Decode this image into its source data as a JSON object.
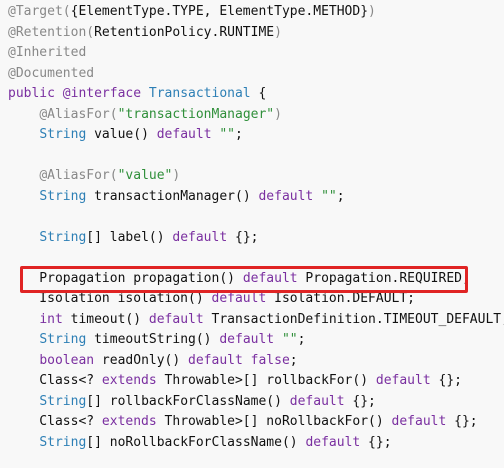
{
  "colors": {
    "background": "#f8f8f8",
    "annotation": "#888888",
    "keyword": "#7a2fa0",
    "string": "#2f8f3a",
    "type": "#2d7fb5",
    "plain": "#111111",
    "highlight_border": "#e02424"
  },
  "code": {
    "highlighted_line_index": 13,
    "lines": [
      [
        {
          "t": "@Target(",
          "c": "ann"
        },
        {
          "t": "{ElementType.TYPE, ElementType.METHOD}",
          "c": "pln"
        },
        {
          "t": ")",
          "c": "ann"
        }
      ],
      [
        {
          "t": "@Retention(",
          "c": "ann"
        },
        {
          "t": "RetentionPolicy.RUNTIME",
          "c": "pln"
        },
        {
          "t": ")",
          "c": "ann"
        }
      ],
      [
        {
          "t": "@Inherited",
          "c": "ann"
        }
      ],
      [
        {
          "t": "@Documented",
          "c": "ann"
        }
      ],
      [
        {
          "t": "public ",
          "c": "kw"
        },
        {
          "t": "@interface ",
          "c": "kw"
        },
        {
          "t": "Transactional",
          "c": "typ"
        },
        {
          "t": " {",
          "c": "pln"
        }
      ],
      [
        {
          "t": "    ",
          "c": "pln"
        },
        {
          "t": "@AliasFor(",
          "c": "ann"
        },
        {
          "t": "\"transactionManager\"",
          "c": "str"
        },
        {
          "t": ")",
          "c": "ann"
        }
      ],
      [
        {
          "t": "    ",
          "c": "pln"
        },
        {
          "t": "String",
          "c": "typ"
        },
        {
          "t": " value() ",
          "c": "pln"
        },
        {
          "t": "default",
          "c": "kw"
        },
        {
          "t": " ",
          "c": "pln"
        },
        {
          "t": "\"\"",
          "c": "str"
        },
        {
          "t": ";",
          "c": "pln"
        }
      ],
      [],
      [
        {
          "t": "    ",
          "c": "pln"
        },
        {
          "t": "@AliasFor(",
          "c": "ann"
        },
        {
          "t": "\"value\"",
          "c": "str"
        },
        {
          "t": ")",
          "c": "ann"
        }
      ],
      [
        {
          "t": "    ",
          "c": "pln"
        },
        {
          "t": "String",
          "c": "typ"
        },
        {
          "t": " transactionManager() ",
          "c": "pln"
        },
        {
          "t": "default",
          "c": "kw"
        },
        {
          "t": " ",
          "c": "pln"
        },
        {
          "t": "\"\"",
          "c": "str"
        },
        {
          "t": ";",
          "c": "pln"
        }
      ],
      [],
      [
        {
          "t": "    ",
          "c": "pln"
        },
        {
          "t": "String",
          "c": "typ"
        },
        {
          "t": "[] label() ",
          "c": "pln"
        },
        {
          "t": "default",
          "c": "kw"
        },
        {
          "t": " {};",
          "c": "pln"
        }
      ],
      [],
      [
        {
          "t": "    Propagation propagation() ",
          "c": "pln"
        },
        {
          "t": "default",
          "c": "kw"
        },
        {
          "t": " Propagation.REQUIRED;",
          "c": "pln"
        }
      ],
      [
        {
          "t": "    Isolation isolation() ",
          "c": "pln"
        },
        {
          "t": "default",
          "c": "kw"
        },
        {
          "t": " Isolation.DEFAULT;",
          "c": "pln"
        }
      ],
      [
        {
          "t": "    ",
          "c": "pln"
        },
        {
          "t": "int",
          "c": "kw"
        },
        {
          "t": " timeout() ",
          "c": "pln"
        },
        {
          "t": "default",
          "c": "kw"
        },
        {
          "t": " TransactionDefinition.TIMEOUT_DEFAULT;",
          "c": "pln"
        }
      ],
      [
        {
          "t": "    ",
          "c": "pln"
        },
        {
          "t": "String",
          "c": "typ"
        },
        {
          "t": " timeoutString() ",
          "c": "pln"
        },
        {
          "t": "default",
          "c": "kw"
        },
        {
          "t": " ",
          "c": "pln"
        },
        {
          "t": "\"\"",
          "c": "str"
        },
        {
          "t": ";",
          "c": "pln"
        }
      ],
      [
        {
          "t": "    ",
          "c": "pln"
        },
        {
          "t": "boolean",
          "c": "kw"
        },
        {
          "t": " readOnly() ",
          "c": "pln"
        },
        {
          "t": "default",
          "c": "kw"
        },
        {
          "t": " ",
          "c": "pln"
        },
        {
          "t": "false",
          "c": "kw"
        },
        {
          "t": ";",
          "c": "pln"
        }
      ],
      [
        {
          "t": "    Class<? ",
          "c": "pln"
        },
        {
          "t": "extends",
          "c": "kw"
        },
        {
          "t": " Throwable>[] rollbackFor() ",
          "c": "pln"
        },
        {
          "t": "default",
          "c": "kw"
        },
        {
          "t": " {};",
          "c": "pln"
        }
      ],
      [
        {
          "t": "    ",
          "c": "pln"
        },
        {
          "t": "String",
          "c": "typ"
        },
        {
          "t": "[] rollbackForClassName() ",
          "c": "pln"
        },
        {
          "t": "default",
          "c": "kw"
        },
        {
          "t": " {};",
          "c": "pln"
        }
      ],
      [
        {
          "t": "    Class<? ",
          "c": "pln"
        },
        {
          "t": "extends",
          "c": "kw"
        },
        {
          "t": " Throwable>[] noRollbackFor() ",
          "c": "pln"
        },
        {
          "t": "default",
          "c": "kw"
        },
        {
          "t": " {};",
          "c": "pln"
        }
      ],
      [
        {
          "t": "    ",
          "c": "pln"
        },
        {
          "t": "String",
          "c": "typ"
        },
        {
          "t": "[] noRollbackForClassName() ",
          "c": "pln"
        },
        {
          "t": "default",
          "c": "kw"
        },
        {
          "t": " {};",
          "c": "pln"
        }
      ]
    ]
  }
}
